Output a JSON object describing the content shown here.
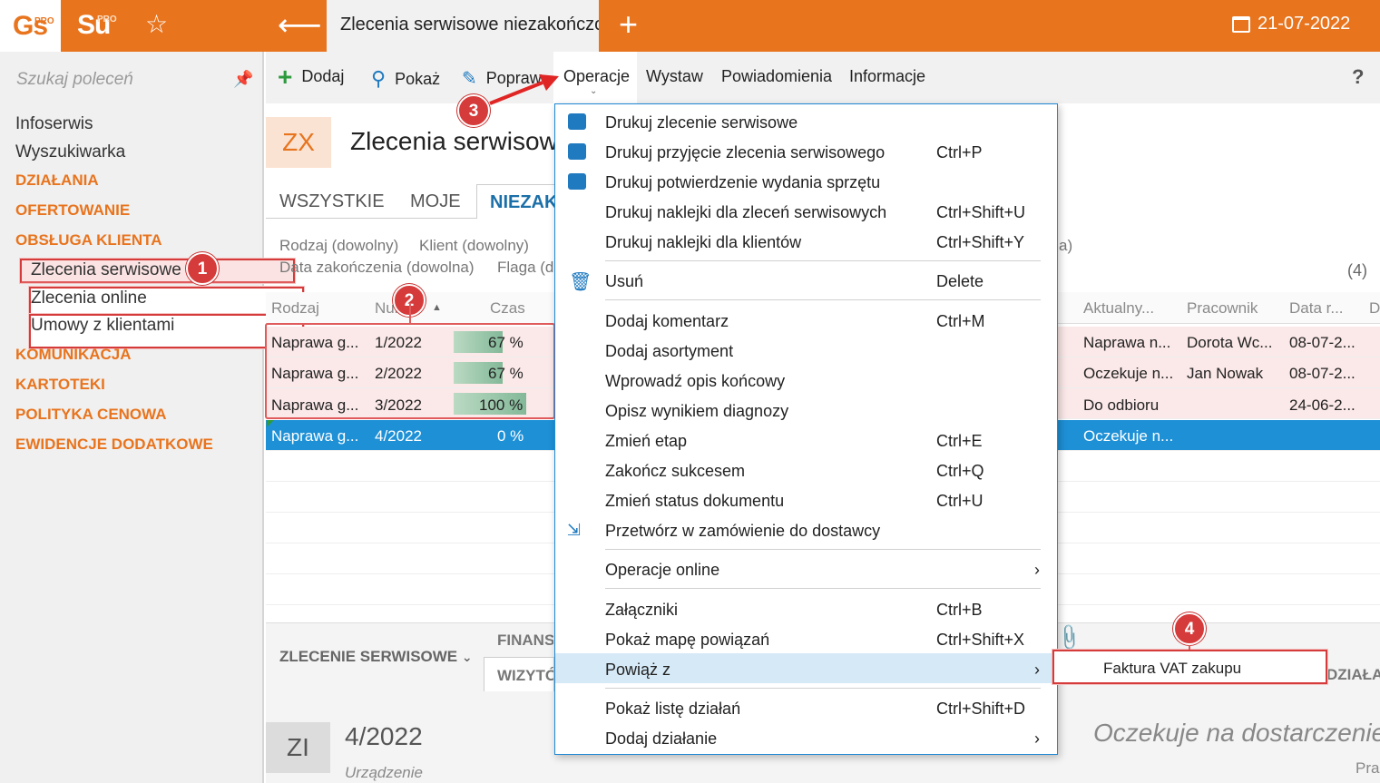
{
  "topbar": {
    "logo_gs": "Gs",
    "logo_su": "Su",
    "pro": "PRO",
    "tab_title": "Zlecenia serwisowe niezakończone",
    "date": "21-07-2022"
  },
  "sidebar": {
    "search_placeholder": "Szukaj poleceń",
    "items": [
      {
        "label": "Infoserwis"
      },
      {
        "label": "Wyszukiwarka"
      },
      {
        "label": "DZIAŁANIA"
      },
      {
        "label": "OFERTOWANIE"
      },
      {
        "label": "OBSŁUGA KLIENTA"
      },
      {
        "label": "Zlecenia serwisowe"
      },
      {
        "label": "Zlecenia online"
      },
      {
        "label": "Umowy z klientami"
      },
      {
        "label": "KOMUNIKACJA"
      },
      {
        "label": "KARTOTEKI"
      },
      {
        "label": "POLITYKA CENOWA"
      },
      {
        "label": "EWIDENCJE DODATKOWE"
      }
    ]
  },
  "toolbar": {
    "add": "Dodaj",
    "show": "Pokaż",
    "edit": "Popraw",
    "operations": "Operacje",
    "issue": "Wystaw",
    "notifications": "Powiadomienia",
    "info": "Informacje",
    "help": "?"
  },
  "header": {
    "badge": "ZX",
    "title": "Zlecenia serwisowe niezakończone"
  },
  "tabs": {
    "all": "WSZYSTKIE",
    "mine": "MOJE",
    "unfinished": "NIEZAKOŃCZONE"
  },
  "filters": {
    "kind": "Rodzaj (dowolny)",
    "client": "Klient (dowolny)",
    "end_date": "Data zakończenia (dowolna)",
    "flag": "Flaga (dowolna)",
    "trail": "a)",
    "count": "(4)"
  },
  "columns": {
    "kind": "Rodzaj",
    "number": "Numer",
    "time": "Czas",
    "current": "Aktualny...",
    "worker": "Pracownik",
    "date": "Data r...",
    "d": "D"
  },
  "rows": [
    {
      "kind": "Naprawa g...",
      "number": "1/2022",
      "time": "67 %",
      "progress": 0.67,
      "current": "Naprawa n...",
      "worker": "Dorota Wc...",
      "date": "08-07-2..."
    },
    {
      "kind": "Naprawa g...",
      "number": "2/2022",
      "time": "67 %",
      "progress": 0.67,
      "current": "Oczekuje n...",
      "worker": "Jan Nowak",
      "date": "08-07-2..."
    },
    {
      "kind": "Naprawa g...",
      "number": "3/2022",
      "time": "100 %",
      "progress": 1.0,
      "current": "Do odbioru",
      "worker": "",
      "date": "24-06-2..."
    },
    {
      "kind": "Naprawa g...",
      "number": "4/2022",
      "time": "0 %",
      "progress": 0.0,
      "current": "Oczekuje n...",
      "worker": "",
      "date": ""
    }
  ],
  "menu": {
    "items": [
      {
        "label": "Drukuj zlecenie serwisowe",
        "shortcut": ""
      },
      {
        "label": "Drukuj przyjęcie zlecenia serwisowego",
        "shortcut": "Ctrl+P"
      },
      {
        "label": "Drukuj potwierdzenie wydania sprzętu",
        "shortcut": ""
      },
      {
        "label": "Drukuj naklejki dla zleceń serwisowych",
        "shortcut": "Ctrl+Shift+U"
      },
      {
        "label": "Drukuj naklejki dla klientów",
        "shortcut": "Ctrl+Shift+Y"
      },
      {
        "label": "Usuń",
        "shortcut": "Delete"
      },
      {
        "label": "Dodaj komentarz",
        "shortcut": "Ctrl+M"
      },
      {
        "label": "Dodaj asortyment",
        "shortcut": ""
      },
      {
        "label": "Wprowadź opis końcowy",
        "shortcut": ""
      },
      {
        "label": "Opisz wynikiem diagnozy",
        "shortcut": ""
      },
      {
        "label": "Zmień etap",
        "shortcut": "Ctrl+E"
      },
      {
        "label": "Zakończ sukcesem",
        "shortcut": "Ctrl+Q"
      },
      {
        "label": "Zmień status dokumentu",
        "shortcut": "Ctrl+U"
      },
      {
        "label": "Przetwórz w zamówienie do dostawcy",
        "shortcut": ""
      },
      {
        "label": "Operacje online",
        "shortcut": ""
      },
      {
        "label": "Załączniki",
        "shortcut": "Ctrl+B"
      },
      {
        "label": "Pokaż mapę powiązań",
        "shortcut": "Ctrl+Shift+X"
      },
      {
        "label": "Powiąż z",
        "shortcut": ""
      },
      {
        "label": "Pokaż listę działań",
        "shortcut": "Ctrl+Shift+D"
      },
      {
        "label": "Dodaj działanie",
        "shortcut": ""
      }
    ],
    "submenu_item": "Faktura VAT zakupu"
  },
  "lower": {
    "section": "ZLECENIE SERWISOWE",
    "finance": "FINANSE",
    "visits": "WIZYTÓWKA",
    "actions": "DZIAŁANIA",
    "badge": "ZI",
    "number": "4/2022",
    "device": "Urządzenie",
    "status": "Oczekuje na dostarczenie",
    "prac": "Prac"
  },
  "annotations": [
    "1",
    "2",
    "3",
    "4"
  ]
}
